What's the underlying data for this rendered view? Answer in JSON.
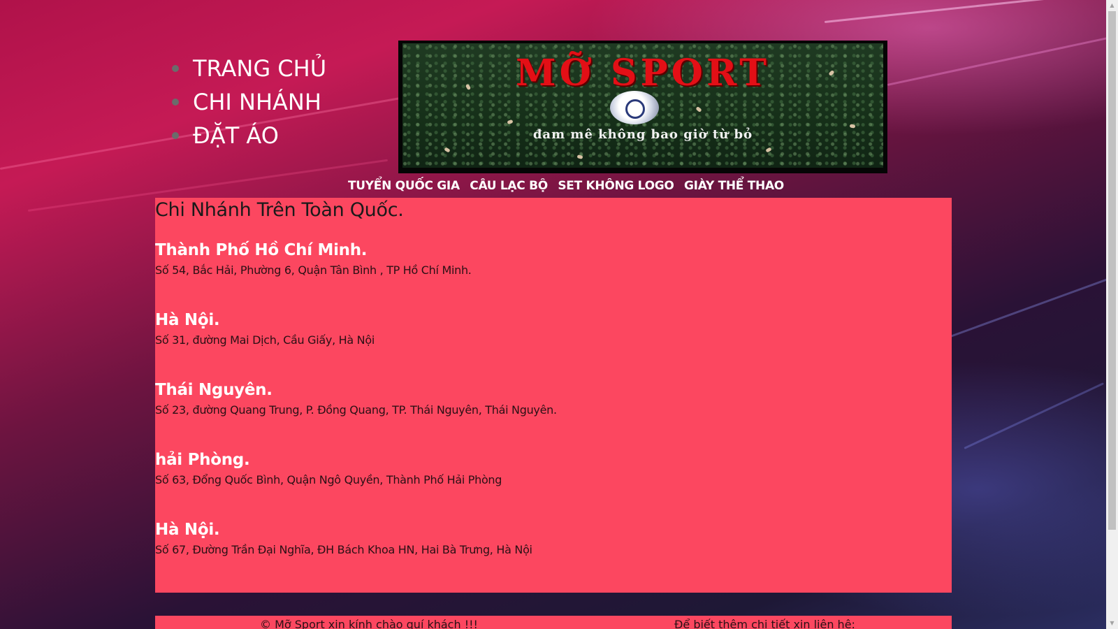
{
  "side_menu": {
    "items": [
      {
        "label": "TRANG CHỦ"
      },
      {
        "label": "CHI NHÁNH"
      },
      {
        "label": "ĐẶT ÁO"
      }
    ]
  },
  "banner": {
    "brand": "MỠ SPORT",
    "slogan": "đam mê không bao giờ từ bỏ"
  },
  "top_nav": {
    "items": [
      {
        "label": "TUYỂN QUỐC GIA"
      },
      {
        "label": "CÂU LẠC BỘ"
      },
      {
        "label": "SET KHÔNG LOGO"
      },
      {
        "label": "GIÀY THỂ THAO"
      }
    ]
  },
  "main": {
    "heading": "Chi Nhánh Trên Toàn Quốc.",
    "branches": [
      {
        "city": "Thành Phố Hồ Chí Minh.",
        "address": "Số 54, Bắc Hải, Phường 6, Quận Tân Bình , TP Hồ Chí Minh."
      },
      {
        "city": "Hà Nội.",
        "address": "Số 31, đường Mai Dịch, Cầu Giấy, Hà Nội"
      },
      {
        "city": "Thái Nguyên.",
        "address": "Số 23, đường Quang Trung, P. Đồng Quang, TP. Thái Nguyên, Thái Nguyên."
      },
      {
        "city": "hải Phòng.",
        "address": "Số 63, Đổng Quốc Bình, Quận Ngô Quyền, Thành Phố Hải Phòng"
      },
      {
        "city": "Hà Nội.",
        "address": "Số 67, Đường Trần Đại Nghĩa, ĐH Bách Khoa HN, Hai Bà Trưng, Hà Nội"
      }
    ]
  },
  "footer": {
    "greeting": "© Mỡ Sport xin kính chào quí khách !!!",
    "contact": "Để biết thêm chi tiết xin liên hệ:"
  },
  "colors": {
    "content_bg": "#fc4760",
    "accent_red": "#e30f16"
  }
}
